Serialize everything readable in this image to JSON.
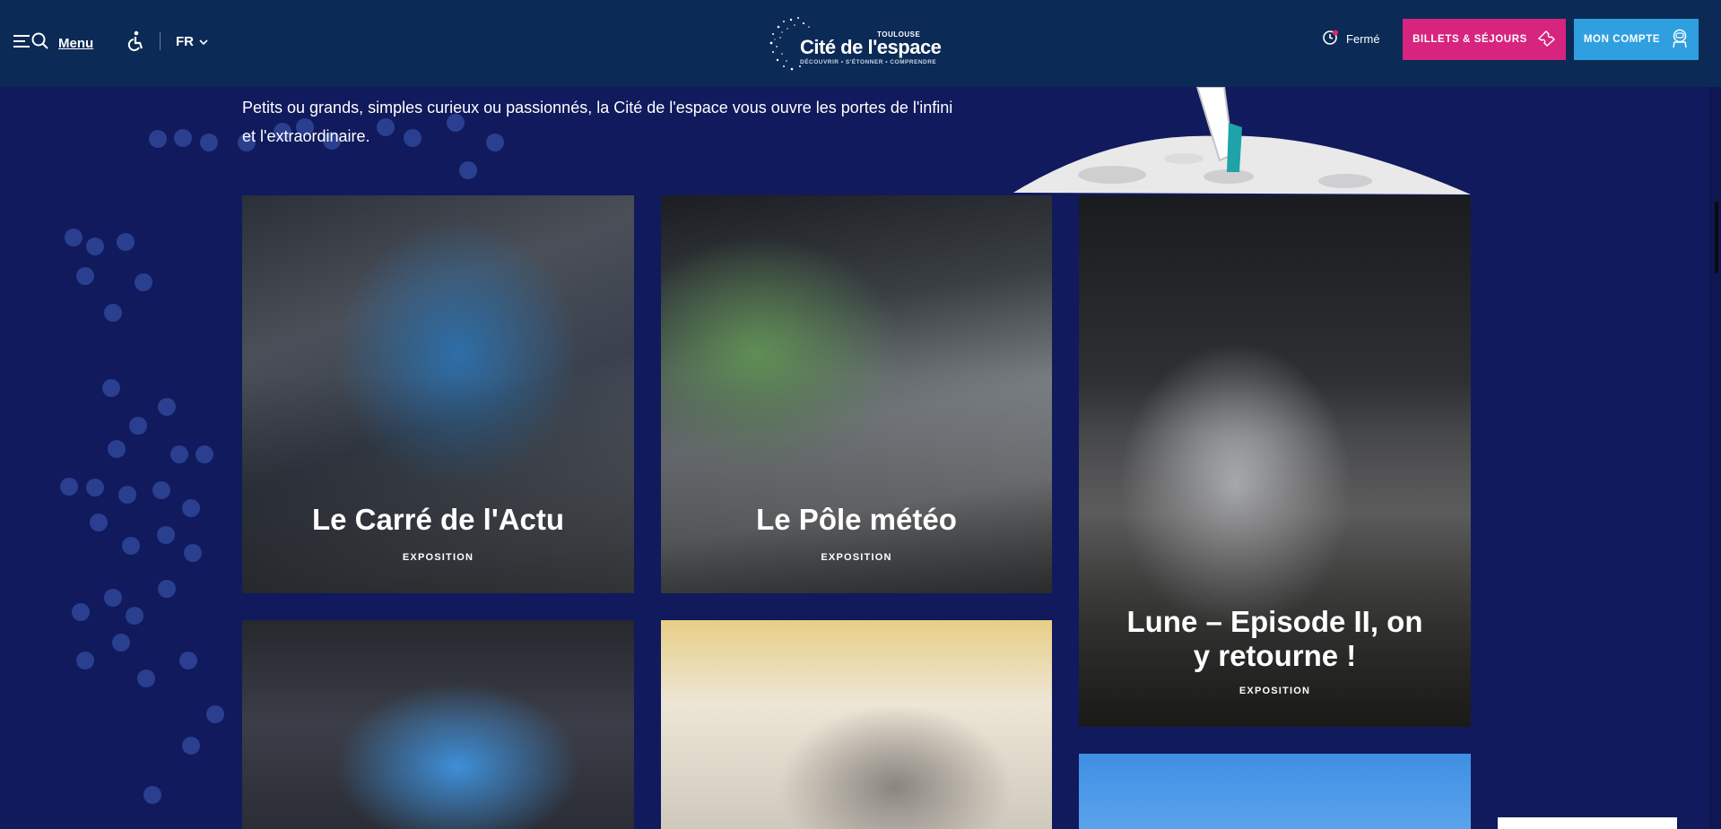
{
  "header": {
    "menu_label": "Menu",
    "lang_label": "FR",
    "logo": {
      "city": "TOULOUSE",
      "name": "Cité de l'espace",
      "tagline": "DÉCOUVRIR • S'ÉTONNER • COMPRENDRE"
    },
    "status_label": "Fermé",
    "tickets_label": "BILLETS & SÉJOURS",
    "account_label": "MON COMPTE"
  },
  "intro": {
    "text": "Petits ou grands, simples curieux ou passionnés, la Cité de l'espace vous ouvre les portes de l'infini et l'extraordinaire."
  },
  "cards": [
    {
      "title": "Le Carré de l'Actu",
      "tag": "EXPOSITION"
    },
    {
      "title": "Le Pôle météo",
      "tag": "EXPOSITION"
    },
    {
      "title": "Lune – Episode II, on y retourne !",
      "tag": "EXPOSITION"
    }
  ],
  "colors": {
    "header_bg": "#0b2a55",
    "page_bg": "#101a5c",
    "tickets_btn": "#d6247f",
    "account_btn": "#2f9fe0"
  },
  "icons": [
    "menu-icon",
    "search-icon",
    "accessibility-icon",
    "chevron-down-icon",
    "clock-icon",
    "ticket-icon",
    "astronaut-icon"
  ]
}
